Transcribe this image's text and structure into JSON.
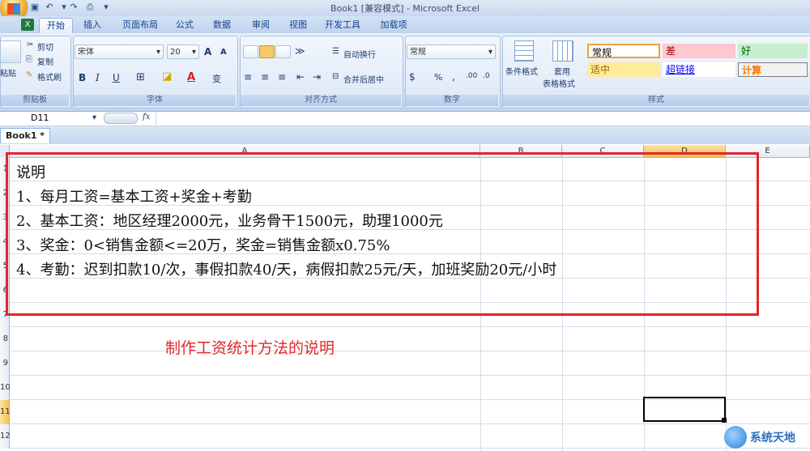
{
  "window": {
    "title": "Book1  [兼容模式] - Microsoft Excel"
  },
  "quick_access": {
    "icons": [
      "save-icon",
      "undo-icon",
      "redo-icon",
      "print-preview-icon"
    ]
  },
  "tabs": [
    "开始",
    "插入",
    "页面布局",
    "公式",
    "数据",
    "审阅",
    "视图",
    "开发工具",
    "加载项"
  ],
  "ribbon": {
    "clipboard": {
      "label": "剪贴板",
      "paste": "粘贴",
      "cut": "剪切",
      "copy": "复制",
      "format_painter": "格式刷"
    },
    "font": {
      "label": "字体",
      "font_name": "宋体",
      "font_size": "20",
      "bold": "B",
      "italic": "I",
      "underline": "U",
      "grow": "A",
      "shrink": "A",
      "font_color_glyph": "A",
      "phonetic": "变"
    },
    "alignment": {
      "label": "对齐方式",
      "wrap_text": "自动换行",
      "merge_center": "合并后居中"
    },
    "number": {
      "label": "数字",
      "format": "常规",
      "percent": "%",
      "comma": ",",
      "inc_decimal": ".00",
      "dec_decimal": ".0"
    },
    "styles": {
      "label": "样式",
      "conditional_format": "条件格式",
      "table_format_1": "套用",
      "table_format_2": "表格格式",
      "cells": [
        {
          "label": "常规",
          "bg": "#ffffff",
          "fg": "#000000"
        },
        {
          "label": "差",
          "bg": "#ffc7ce",
          "fg": "#9c0006"
        },
        {
          "label": "好",
          "bg": "#c6efce",
          "fg": "#006100"
        },
        {
          "label": "适中",
          "bg": "#ffeb9c",
          "fg": "#9c6500"
        },
        {
          "label": "超链接",
          "bg": "#ffffff",
          "fg": "#0000ff"
        },
        {
          "label": "计算",
          "bg": "#f2f2f2",
          "fg": "#fa7d00"
        }
      ]
    }
  },
  "formula_bar": {
    "name_box": "D11",
    "fx": "fx"
  },
  "workbook_tab": "Book1 *",
  "columns": [
    "A",
    "B",
    "C",
    "D",
    "E"
  ],
  "rows": [
    "1",
    "2",
    "3",
    "4",
    "5",
    "6",
    "7",
    "8",
    "9",
    "10",
    "11",
    "12"
  ],
  "cells": [
    "说明",
    "1、每月工资=基本工资+奖金+考勤",
    "2、基本工资：地区经理2000元，业务骨干1500元，助理1000元",
    "3、奖金：0<销售金额<=20万，奖金=销售金额x0.75%",
    "4、考勤：迟到扣款10/次，事假扣款40/天，病假扣款25元/天，加班奖励20元/小时"
  ],
  "caption": "制作工资统计方法的说明",
  "watermark": {
    "text": "系统天地"
  },
  "colors": {
    "accent_red": "#e3262b",
    "ribbon_blue": "#15428b"
  }
}
